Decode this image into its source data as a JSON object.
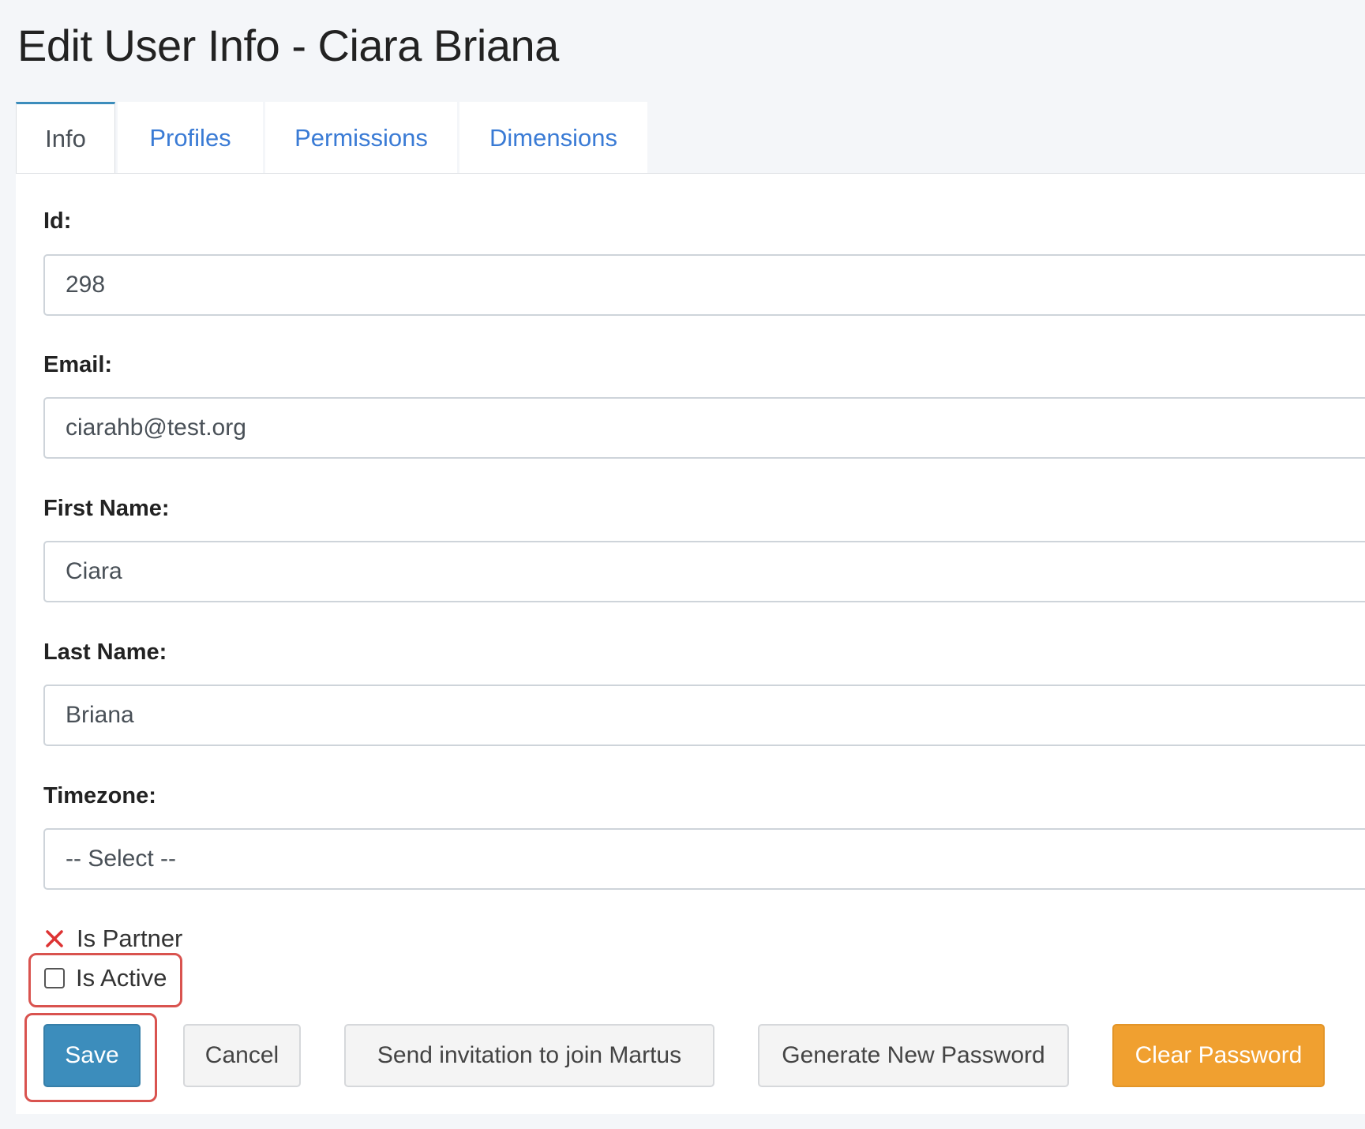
{
  "page": {
    "title": "Edit User Info - Ciara Briana"
  },
  "tabs": [
    {
      "label": "Info",
      "active": true
    },
    {
      "label": "Profiles",
      "active": false
    },
    {
      "label": "Permissions",
      "active": false
    },
    {
      "label": "Dimensions",
      "active": false
    }
  ],
  "form": {
    "id": {
      "label": "Id:",
      "value": "298"
    },
    "email": {
      "label": "Email:",
      "value": "ciarahb@test.org"
    },
    "first_name": {
      "label": "First Name:",
      "value": "Ciara"
    },
    "last_name": {
      "label": "Last Name:",
      "value": "Briana"
    },
    "timezone": {
      "label": "Timezone:",
      "value": "-- Select --"
    },
    "is_partner": {
      "label": "Is Partner",
      "checked": false,
      "icon": "x-icon"
    },
    "is_active": {
      "label": "Is Active",
      "checked": false
    }
  },
  "buttons": {
    "save": "Save",
    "cancel": "Cancel",
    "send_invitation": "Send invitation to join Martus",
    "generate_password": "Generate New Password",
    "clear_password": "Clear Password"
  },
  "colors": {
    "primary": "#3c8dbc",
    "warning": "#f0a030",
    "link": "#3a7bd5",
    "highlight": "#d9534f",
    "x_mark": "#dd3333"
  }
}
